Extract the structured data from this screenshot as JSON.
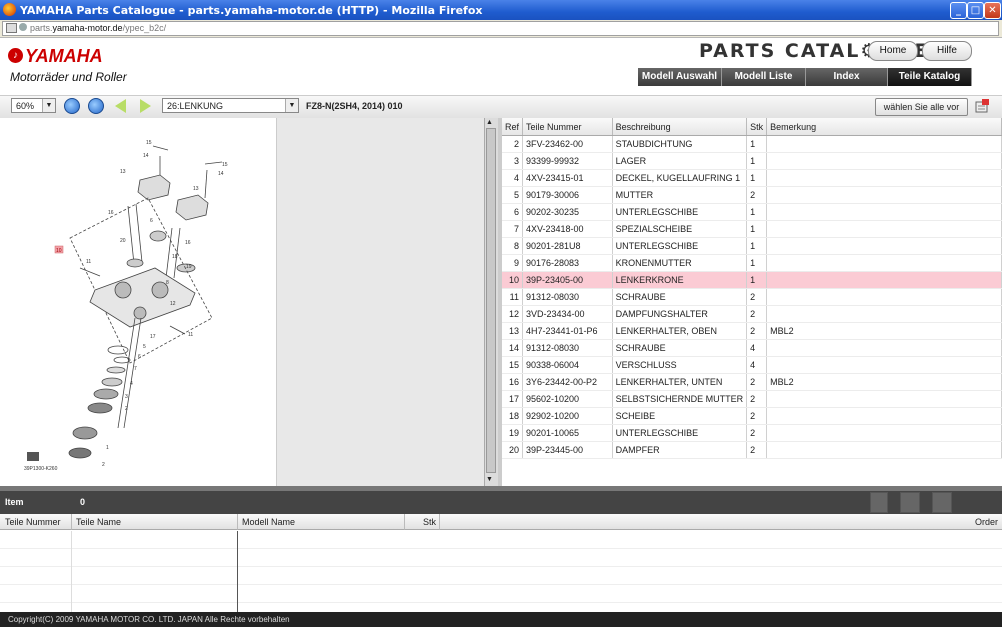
{
  "window": {
    "title": "YAMAHA Parts Catalogue - parts.yamaha-motor.de (HTTP) - Mozilla Firefox"
  },
  "address_bar": {
    "domain_prefix": "parts.",
    "domain": "yamaha-motor.de",
    "path": "/ypec_b2c/"
  },
  "header": {
    "brand": "YAMAHA",
    "subtitle": "Motorräder und Roller",
    "catalogue_title": "PARTS CATAL⚙GUE",
    "home_label": "Home",
    "help_label": "Hilfe",
    "tabs": [
      {
        "label": "Modell Auswahl"
      },
      {
        "label": "Modell Liste"
      },
      {
        "label": "Index"
      },
      {
        "label": "Teile Katalog"
      }
    ]
  },
  "toolbar": {
    "zoom_value": "60%",
    "section_value": "26:LENKUNG",
    "model_text": "FZ8-N(2SH4, 2014) 010",
    "select_all_label": "wählen Sie alle vor"
  },
  "diagram": {
    "caption": "39P1300-K260",
    "highlight_label": "10"
  },
  "parts_table": {
    "headers": [
      "Ref",
      "Teile Nummer",
      "Beschreibung",
      "Stk",
      "Bemerkung"
    ],
    "rows": [
      [
        "2",
        "3FV-23462-00",
        "STAUBDICHTUNG",
        "1",
        ""
      ],
      [
        "3",
        "93399-99932",
        "LAGER",
        "1",
        ""
      ],
      [
        "4",
        "4XV-23415-01",
        "DECKEL, KUGELLAUFRING 1",
        "1",
        ""
      ],
      [
        "5",
        "90179-30006",
        "MUTTER",
        "2",
        ""
      ],
      [
        "6",
        "90202-30235",
        "UNTERLEGSCHIBE",
        "1",
        ""
      ],
      [
        "7",
        "4XV-23418-00",
        "SPEZIALSCHEIBE",
        "1",
        ""
      ],
      [
        "8",
        "90201-281U8",
        "UNTERLEGSCHIBE",
        "1",
        ""
      ],
      [
        "9",
        "90176-28083",
        "KRONENMUTTER",
        "1",
        ""
      ],
      [
        "10",
        "39P-23405-00",
        "LENKERKRONE",
        "1",
        ""
      ],
      [
        "11",
        "91312-08030",
        "SCHRAUBE",
        "2",
        ""
      ],
      [
        "12",
        "3VD-23434-00",
        "DAMPFUNGSHALTER",
        "2",
        ""
      ],
      [
        "13",
        "4H7-23441-01-P6",
        "LENKERHALTER, OBEN",
        "2",
        "MBL2"
      ],
      [
        "14",
        "91312-08030",
        "SCHRAUBE",
        "4",
        ""
      ],
      [
        "15",
        "90338-06004",
        "VERSCHLUSS",
        "4",
        ""
      ],
      [
        "16",
        "3Y6-23442-00-P2",
        "LENKERHALTER, UNTEN",
        "2",
        "MBL2"
      ],
      [
        "17",
        "95602-10200",
        "SELBSTSICHERNDE MUTTER",
        "2",
        ""
      ],
      [
        "18",
        "92902-10200",
        "SCHEIBE",
        "2",
        ""
      ],
      [
        "19",
        "90201-10065",
        "UNTERLEGSCHIBE",
        "2",
        ""
      ],
      [
        "20",
        "39P-23445-00",
        "DAMPFER",
        "2",
        ""
      ]
    ],
    "selected_ref": "10"
  },
  "order": {
    "item_label": "Item",
    "item_count": "0",
    "headers": [
      "Teile Nummer",
      "Teile Name",
      "Modell Name",
      "Stk",
      "Order"
    ]
  },
  "footer": {
    "copyright": "Copyright(C) 2009 YAMAHA MOTOR CO. LTD. JAPAN Alle Rechte vorbehalten"
  },
  "colors": {
    "selected_row": "#fbcbd4",
    "brand_red": "#cc0000",
    "titlebar_blue": "#1f5ccf"
  }
}
